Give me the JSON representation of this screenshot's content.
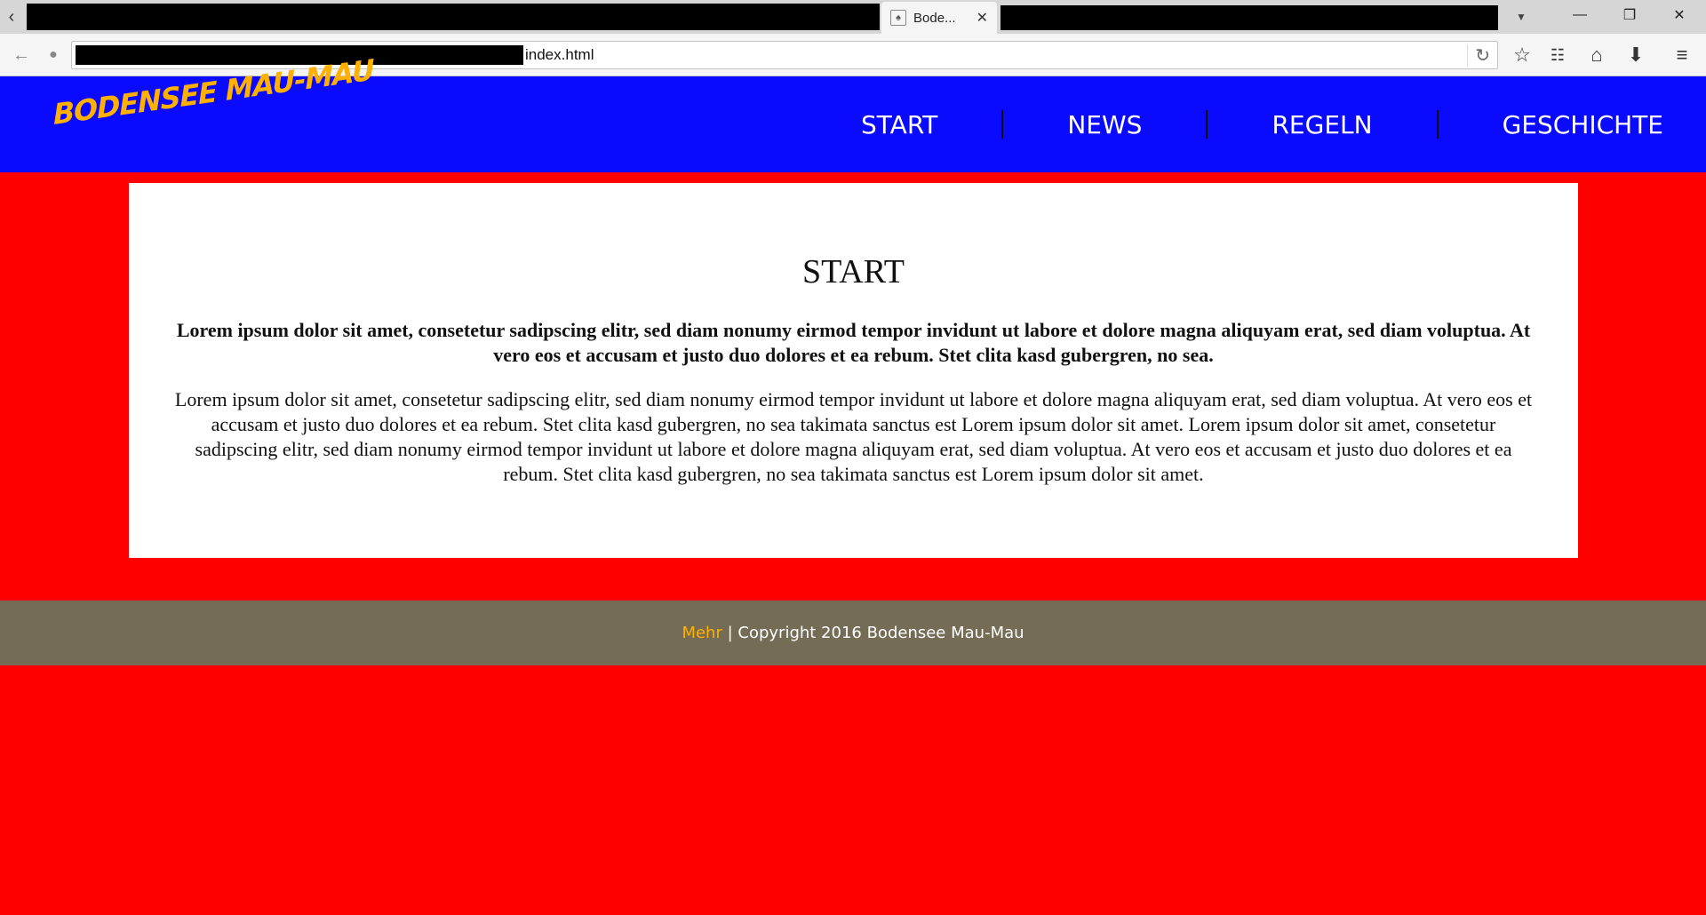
{
  "browser": {
    "tab_title": "Bode...",
    "url_suffix": "index.html"
  },
  "site": {
    "logo": "BODENSEE MAU-MAU",
    "nav": [
      "START",
      "NEWS",
      "REGELN",
      "GESCHICHTE"
    ]
  },
  "content": {
    "title": "START",
    "lead": "Lorem ipsum dolor sit amet, consetetur sadipscing elitr, sed diam nonumy eirmod tempor invidunt ut labore et dolore magna aliquyam erat, sed diam voluptua. At vero eos et accusam et justo duo dolores et ea rebum. Stet clita kasd gubergren, no sea.",
    "body": "Lorem ipsum dolor sit amet, consetetur sadipscing elitr, sed diam nonumy eirmod tempor invidunt ut labore et dolore magna aliquyam erat, sed diam voluptua. At vero eos et accusam et justo duo dolores et ea rebum. Stet clita kasd gubergren, no sea takimata sanctus est Lorem ipsum dolor sit amet. Lorem ipsum dolor sit amet, consetetur sadipscing elitr, sed diam nonumy eirmod tempor invidunt ut labore et dolore magna aliquyam erat, sed diam voluptua. At vero eos et accusam et justo duo dolores et ea rebum. Stet clita kasd gubergren, no sea takimata sanctus est Lorem ipsum dolor sit amet."
  },
  "footer": {
    "link": "Mehr",
    "text": " | Copyright 2016 Bodensee Mau-Mau"
  },
  "colors": {
    "page_bg": "#ff0000",
    "header_bg": "#0a0aff",
    "accent": "#ffb000",
    "footer_bg": "#756c56"
  }
}
